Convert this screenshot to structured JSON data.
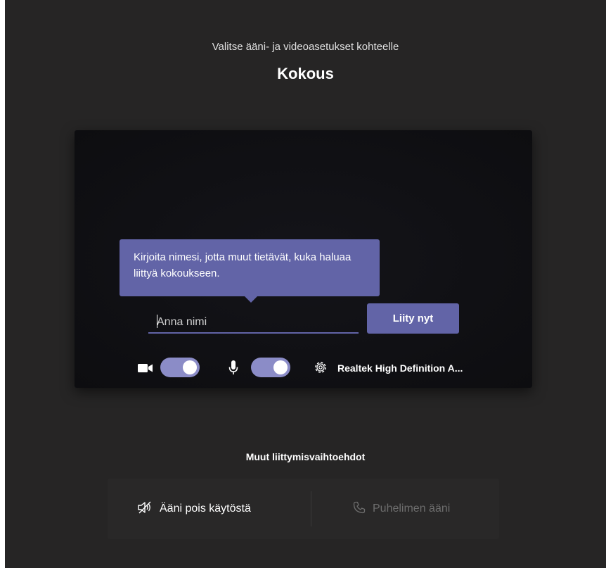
{
  "header": {
    "subtitle": "Valitse ääni- ja videoasetukset kohteelle",
    "meeting_title": "Kokous"
  },
  "preview": {
    "tooltip": "Kirjoita nimesi, jotta muut tietävät, kuka haluaa liittyä kokoukseen.",
    "name_input": {
      "value": "",
      "placeholder": "Anna nimi"
    },
    "join_button": "Liity nyt",
    "camera_toggle": {
      "icon": "video-camera-icon",
      "state": "on"
    },
    "mic_toggle": {
      "icon": "microphone-icon",
      "state": "on"
    },
    "device": {
      "icon": "gear-icon",
      "label": "Realtek High Definition A..."
    }
  },
  "other_options": {
    "title": "Muut liittymisvaihtoehdot",
    "audio_off": {
      "icon": "speaker-off-icon",
      "label": "Ääni pois käytöstä"
    },
    "phone_audio": {
      "icon": "phone-icon",
      "label": "Puhelimen ääni",
      "state": "disabled"
    }
  },
  "colors": {
    "background": "#262525",
    "accent": "#6264a7",
    "toggle_on": "#8b8cc7"
  }
}
